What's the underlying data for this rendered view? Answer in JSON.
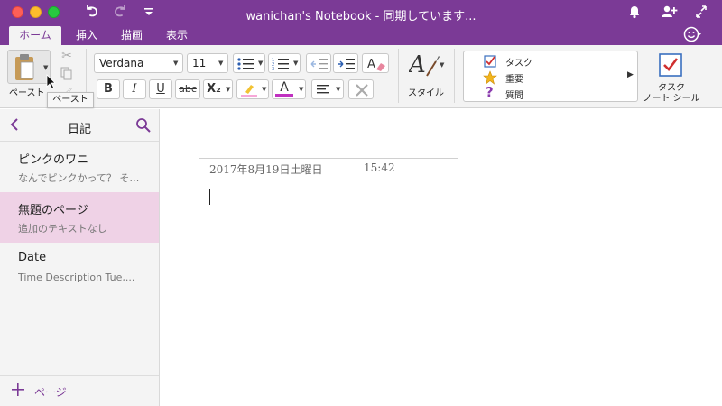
{
  "window": {
    "title": "wanichan's Notebook - 同期しています..."
  },
  "tabs": [
    {
      "label": "ホーム",
      "active": true
    },
    {
      "label": "挿入",
      "active": false
    },
    {
      "label": "描画",
      "active": false
    },
    {
      "label": "表示",
      "active": false
    }
  ],
  "ribbon": {
    "paste_label": "ペースト",
    "font_name": "Verdana",
    "font_size": "11",
    "bold": "B",
    "italic": "I",
    "underline": "U",
    "strike": "abc",
    "subscript": "X₂",
    "font_color_letter": "A",
    "style_label": "スタイル",
    "tags": [
      {
        "label": "タスク",
        "icon": "checkbox-icon"
      },
      {
        "label": "重要",
        "icon": "star-icon"
      },
      {
        "label": "質問",
        "icon": "question-icon"
      }
    ],
    "task_line1": "タスク",
    "task_line2": "ノート シール"
  },
  "tooltip": {
    "text": "ペースト"
  },
  "sidebar": {
    "section_title": "日記",
    "pages": [
      {
        "title": "ピンクのワニ",
        "subtitle": "なんでピンクかって？ そ…"
      },
      {
        "title": "無題のページ",
        "subtitle": "追加のテキストなし",
        "selected": true
      },
      {
        "title": "Date",
        "subtitle": "Time Description Tue,..."
      }
    ],
    "add_page_label": "ページ"
  },
  "note": {
    "date": "2017年8月19日土曜日",
    "time": "15:42"
  },
  "colors": {
    "accent": "#7b3a96",
    "selected_page": "#efd2e6",
    "highlight": "#f7a8d8",
    "font_color": "#c030c0"
  }
}
